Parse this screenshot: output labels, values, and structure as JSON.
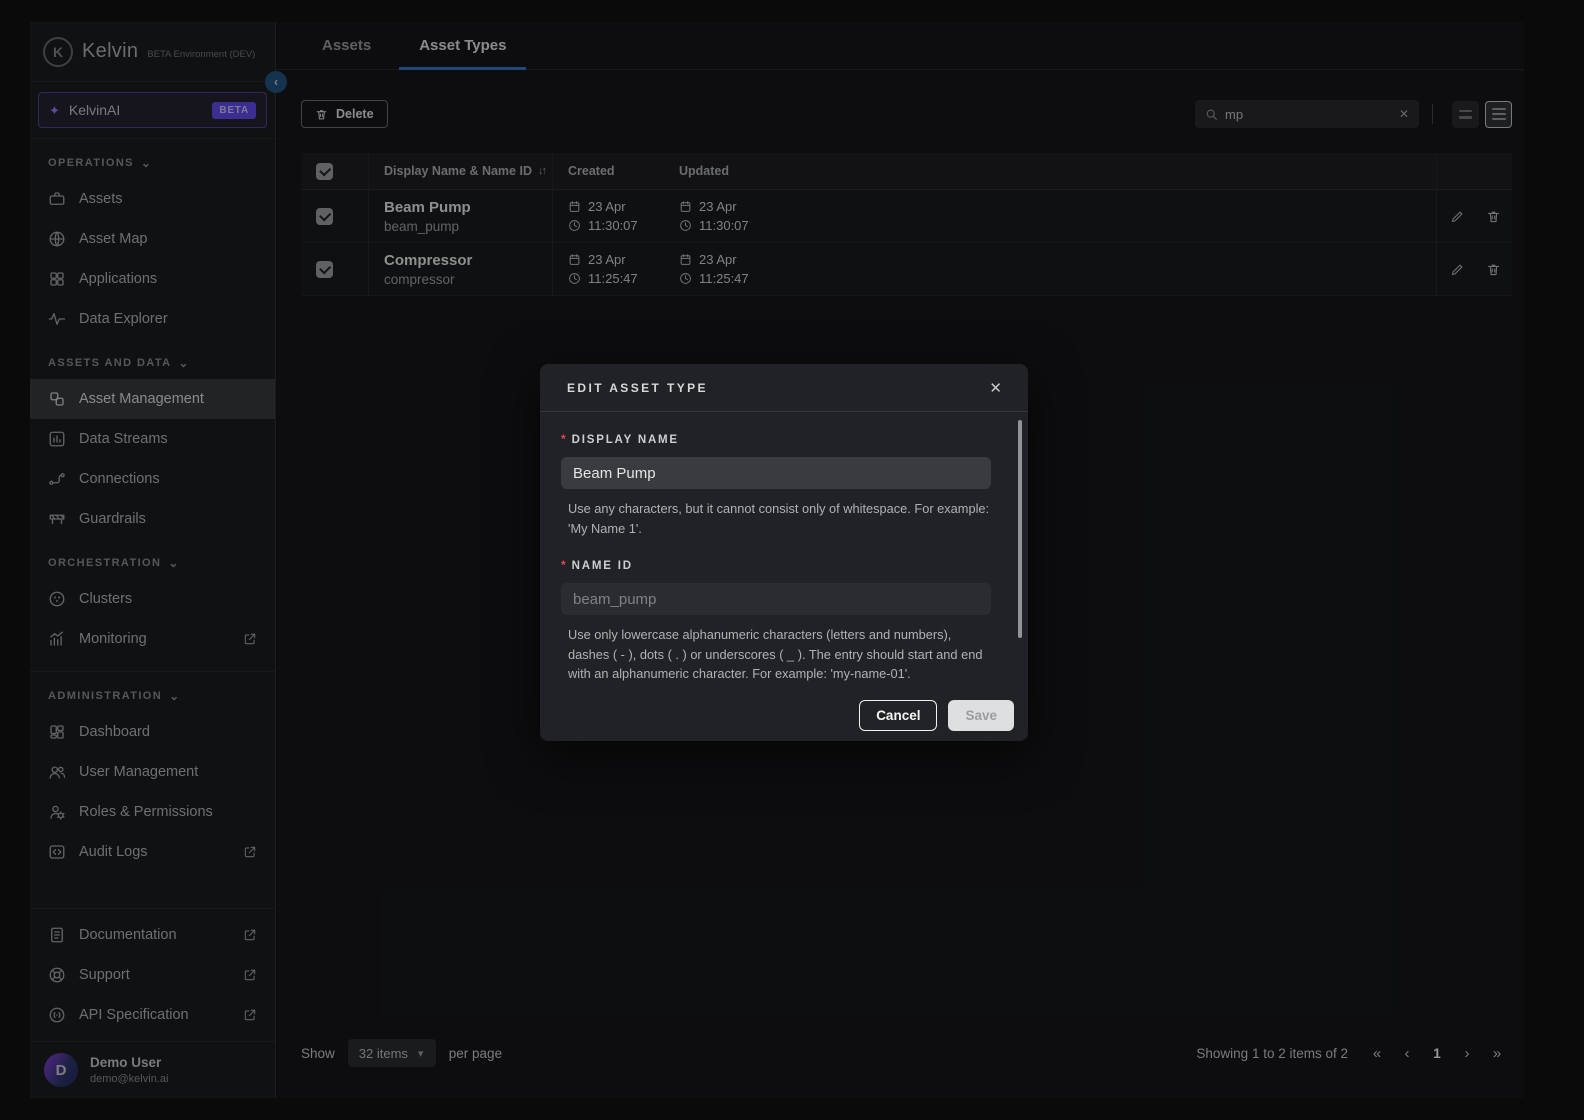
{
  "brand": {
    "logo_initial": "K",
    "name": "Kelvin",
    "env_label": "BETA Environment (DEV)"
  },
  "sidebar": {
    "ai_item": {
      "label": "KelvinAI",
      "badge": "BETA"
    },
    "sections": [
      {
        "title": "OPERATIONS",
        "items": [
          {
            "label": "Assets"
          },
          {
            "label": "Asset Map"
          },
          {
            "label": "Applications"
          },
          {
            "label": "Data Explorer"
          }
        ]
      },
      {
        "title": "ASSETS AND DATA",
        "items": [
          {
            "label": "Asset Management"
          },
          {
            "label": "Data Streams"
          },
          {
            "label": "Connections"
          },
          {
            "label": "Guardrails"
          }
        ]
      },
      {
        "title": "ORCHESTRATION",
        "items": [
          {
            "label": "Clusters"
          },
          {
            "label": "Monitoring"
          }
        ]
      },
      {
        "title": "ADMINISTRATION",
        "items": [
          {
            "label": "Dashboard"
          },
          {
            "label": "User Management"
          },
          {
            "label": "Roles & Permissions"
          },
          {
            "label": "Audit Logs"
          }
        ]
      }
    ],
    "footer_links": [
      {
        "label": "Documentation"
      },
      {
        "label": "Support"
      },
      {
        "label": "API Specification"
      }
    ],
    "user": {
      "name": "Demo User",
      "email": "demo@kelvin.ai",
      "avatar_initial": "D"
    }
  },
  "tabs": [
    {
      "label": "Assets"
    },
    {
      "label": "Asset Types"
    }
  ],
  "toolbar": {
    "delete_label": "Delete",
    "search_value": "mp"
  },
  "table": {
    "columns": {
      "name": "Display Name & Name ID",
      "created": "Created",
      "updated": "Updated"
    },
    "rows": [
      {
        "display_name": "Beam Pump",
        "name_id": "beam_pump",
        "created_date": "23 Apr",
        "created_time": "11:30:07",
        "updated_date": "23 Apr",
        "updated_time": "11:30:07"
      },
      {
        "display_name": "Compressor",
        "name_id": "compressor",
        "created_date": "23 Apr",
        "created_time": "11:25:47",
        "updated_date": "23 Apr",
        "updated_time": "11:25:47"
      }
    ]
  },
  "pagination": {
    "show_label": "Show",
    "page_size": "32 items",
    "per_page_label": "per page",
    "summary": "Showing 1 to 2 items of 2",
    "current_page": "1"
  },
  "modal": {
    "title": "EDIT ASSET TYPE",
    "required_mark": "*",
    "display_name": {
      "label": "DISPLAY NAME",
      "value": "Beam Pump",
      "help": "Use any characters, but it cannot consist only of whitespace. For example: 'My Name 1'."
    },
    "name_id": {
      "label": "NAME ID",
      "placeholder": "beam_pump",
      "help": "Use only lowercase alphanumeric characters (letters and numbers), dashes ( - ), dots ( . ) or underscores ( _ ). The entry should start and end with an alphanumeric character. For example: 'my-name-01'."
    },
    "cancel_label": "Cancel",
    "save_label": "Save"
  },
  "glyphs": {
    "sparkle": "✦",
    "section_caret": "⌄",
    "collapse": "‹",
    "close": "✕",
    "clear": "✕",
    "sort": "↓↑",
    "dropdown_caret": "▾",
    "pag_first": "«",
    "pag_prev": "‹",
    "pag_next": "›",
    "pag_last": "»"
  },
  "colors": {
    "accent_blue": "#2f7cd0",
    "brand_purple": "#614ef2",
    "error_red": "#e5484d"
  }
}
